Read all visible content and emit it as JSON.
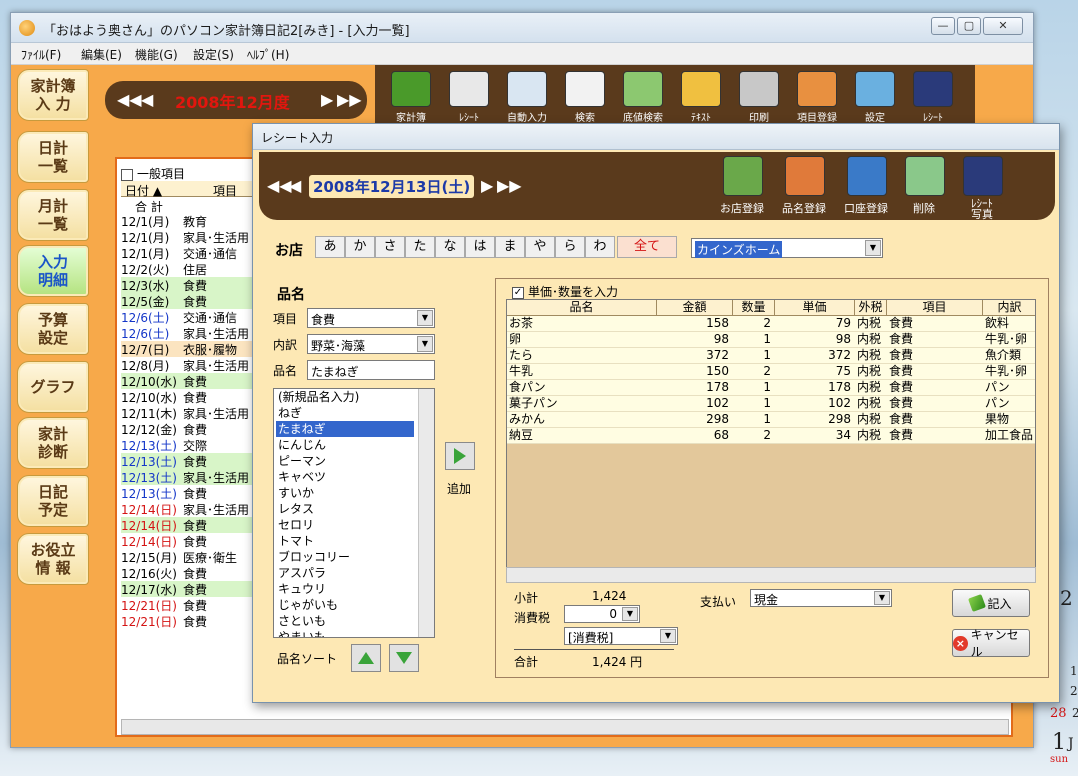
{
  "main_window": {
    "title": "「おはよう奥さん」のパソコン家計簿日記2[みき] - [入力一覧]",
    "menu": [
      "ﾌｧｲﾙ(F)",
      "編集(E)",
      "機能(G)",
      "設定(S)",
      "ﾍﾙﾌﾟ(H)"
    ],
    "win_controls": [
      "—",
      "▢",
      "✕"
    ]
  },
  "sidebar": {
    "items": [
      {
        "label": "家計簿\n入 力"
      },
      {
        "label": "日計\n一覧"
      },
      {
        "label": "月計\n一覧"
      },
      {
        "label": "入力\n明細"
      },
      {
        "label": "予算\n設定"
      },
      {
        "label": "グラフ"
      },
      {
        "label": "家計\n診断"
      },
      {
        "label": "日記\n予定"
      },
      {
        "label": "お役立\n情 報"
      }
    ]
  },
  "month_nav": {
    "prev_prev": "◀◀",
    "prev": "◀",
    "label": "2008年12月度",
    "next": "▶",
    "next_next": "▶▶"
  },
  "main_toolbar": {
    "buttons": [
      {
        "label": "家計簿",
        "icon": "pencil-icon",
        "color": "#4a9a2a"
      },
      {
        "label": "ﾚｼｰﾄ",
        "icon": "receipt-icon",
        "color": "#e8e8e8"
      },
      {
        "label": "自動入力",
        "icon": "calendar-icon",
        "color": "#d9e6f2"
      },
      {
        "label": "検索",
        "icon": "magnifier-icon",
        "color": "#f2f2f2"
      },
      {
        "label": "底値検索",
        "icon": "vegetable-bag-icon",
        "color": "#8cc870"
      },
      {
        "label": "ﾃｷｽﾄ",
        "icon": "text-icon",
        "color": "#f0c040"
      },
      {
        "label": "印刷",
        "icon": "printer-icon",
        "color": "#c8c8c8"
      },
      {
        "label": "項目登録",
        "icon": "shop-icon",
        "color": "#e89040"
      },
      {
        "label": "設定",
        "icon": "blocks-icon",
        "color": "#6ab0e0"
      },
      {
        "label": "ﾚｼｰﾄ",
        "icon": "photo-frame-icon",
        "color": "#2a3a7a"
      }
    ]
  },
  "entry_list": {
    "header_checkbox": "一般項目",
    "col_date": "日付 ▲",
    "col_item": "項目",
    "total_label": "合 計",
    "rows": [
      {
        "date": "12/1(月)",
        "item": "教育",
        "style": "plain",
        "date_color": "black"
      },
      {
        "date": "12/1(月)",
        "item": "家具･生活用",
        "style": "plain",
        "date_color": "black"
      },
      {
        "date": "12/1(月)",
        "item": "交通･通信",
        "style": "plain",
        "date_color": "black"
      },
      {
        "date": "12/2(火)",
        "item": "住居",
        "style": "plain",
        "date_color": "black"
      },
      {
        "date": "12/3(水)",
        "item": "食費",
        "style": "green",
        "date_color": "black"
      },
      {
        "date": "12/5(金)",
        "item": "食費",
        "style": "green",
        "date_color": "black"
      },
      {
        "date": "12/6(土)",
        "item": "交通･通信",
        "style": "plain",
        "date_color": "blue"
      },
      {
        "date": "12/6(土)",
        "item": "家具･生活用",
        "style": "plain",
        "date_color": "blue"
      },
      {
        "date": "12/7(日)",
        "item": "衣服･履物",
        "style": "tan",
        "date_color": "black"
      },
      {
        "date": "12/8(月)",
        "item": "家具･生活用",
        "style": "plain",
        "date_color": "black"
      },
      {
        "date": "12/10(水)",
        "item": "食費",
        "style": "green",
        "date_color": "black"
      },
      {
        "date": "12/10(水)",
        "item": "食費",
        "style": "plain",
        "date_color": "black"
      },
      {
        "date": "12/11(木)",
        "item": "家具･生活用",
        "style": "plain",
        "date_color": "black"
      },
      {
        "date": "12/12(金)",
        "item": "食費",
        "style": "plain",
        "date_color": "black"
      },
      {
        "date": "12/13(土)",
        "item": "交際",
        "style": "plain",
        "date_color": "blue"
      },
      {
        "date": "12/13(土)",
        "item": "食費",
        "style": "green",
        "date_color": "blue"
      },
      {
        "date": "12/13(土)",
        "item": "家具･生活用",
        "style": "green",
        "date_color": "blue"
      },
      {
        "date": "12/13(土)",
        "item": "食費",
        "style": "plain",
        "date_color": "blue"
      },
      {
        "date": "12/14(日)",
        "item": "家具･生活用",
        "style": "plain",
        "date_color": "red"
      },
      {
        "date": "12/14(日)",
        "item": "食費",
        "style": "green",
        "date_color": "red"
      },
      {
        "date": "12/14(日)",
        "item": "食費",
        "style": "plain",
        "date_color": "red"
      },
      {
        "date": "12/15(月)",
        "item": "医療･衛生",
        "style": "plain",
        "date_color": "black"
      },
      {
        "date": "12/16(火)",
        "item": "食費",
        "style": "plain",
        "date_color": "black"
      },
      {
        "date": "12/17(水)",
        "item": "食費",
        "style": "green",
        "date_color": "black"
      },
      {
        "date": "12/21(日)",
        "item": "食費",
        "style": "plain",
        "date_color": "red"
      },
      {
        "date": "12/21(日)",
        "item": "食費",
        "style": "plain",
        "date_color": "red"
      }
    ]
  },
  "dialog": {
    "title": "レシート入力",
    "date_nav": {
      "prev_prev": "◀◀",
      "prev": "◀",
      "label": "2008年12月13日(土)",
      "next": "▶",
      "next_next": "▶▶"
    },
    "tools": [
      {
        "label": "お店登録",
        "icon": "shop-register-icon",
        "color": "#6aa84a"
      },
      {
        "label": "品名登録",
        "icon": "item-register-icon",
        "color": "#e07a3a"
      },
      {
        "label": "口座登録",
        "icon": "bank-card-icon",
        "color": "#3a7ac8"
      },
      {
        "label": "削除",
        "icon": "trash-icon",
        "color": "#8ac88a"
      },
      {
        "label": "ﾚｼｰﾄ\n写真",
        "icon": "photo-frame-icon",
        "color": "#2a3a7a"
      }
    ],
    "shop": {
      "label": "お店",
      "kana": [
        "あ",
        "か",
        "さ",
        "た",
        "な",
        "は",
        "ま",
        "や",
        "ら",
        "わ"
      ],
      "all_label": "全て",
      "selected": "カインズホーム"
    },
    "item": {
      "heading": "品名",
      "category_label": "項目",
      "category_value": "食費",
      "subcategory_label": "内訳",
      "subcategory_value": "野菜･海藻",
      "name_label": "品名",
      "name_value": "たまねぎ",
      "options": [
        "(新規品名入力)",
        "ねぎ",
        "たまねぎ",
        "にんじん",
        "ピーマン",
        "キャベツ",
        "すいか",
        "レタス",
        "セロリ",
        "トマト",
        "ブロッコリー",
        "アスパラ",
        "キュウリ",
        "じゃがいも",
        "さといも",
        "やまいも"
      ],
      "selected_index": 2,
      "add_label": "追加",
      "sort_label": "品名ソート"
    },
    "grid": {
      "checkbox_label": "単価･数量を入力",
      "checkbox_mark": "✓",
      "columns": [
        "品名",
        "金額",
        "数量",
        "単価",
        "外税",
        "項目",
        "内訳"
      ],
      "rows": [
        {
          "name": "お茶",
          "amount": "158",
          "qty": "2",
          "unit": "79",
          "tax": "内税",
          "cat": "食費",
          "sub": "飲料"
        },
        {
          "name": "卵",
          "amount": "98",
          "qty": "1",
          "unit": "98",
          "tax": "内税",
          "cat": "食費",
          "sub": "牛乳･卵"
        },
        {
          "name": "たら",
          "amount": "372",
          "qty": "1",
          "unit": "372",
          "tax": "内税",
          "cat": "食費",
          "sub": "魚介類"
        },
        {
          "name": "牛乳",
          "amount": "150",
          "qty": "2",
          "unit": "75",
          "tax": "内税",
          "cat": "食費",
          "sub": "牛乳･卵"
        },
        {
          "name": "食パン",
          "amount": "178",
          "qty": "1",
          "unit": "178",
          "tax": "内税",
          "cat": "食費",
          "sub": "パン"
        },
        {
          "name": "菓子パン",
          "amount": "102",
          "qty": "1",
          "unit": "102",
          "tax": "内税",
          "cat": "食費",
          "sub": "パン"
        },
        {
          "name": "みかん",
          "amount": "298",
          "qty": "1",
          "unit": "298",
          "tax": "内税",
          "cat": "食費",
          "sub": "果物"
        },
        {
          "name": "納豆",
          "amount": "68",
          "qty": "2",
          "unit": "34",
          "tax": "内税",
          "cat": "食費",
          "sub": "加工食品"
        }
      ]
    },
    "totals": {
      "subtotal_label": "小計",
      "subtotal_value": "1,424",
      "tax_label": "消費税",
      "tax_value": "0",
      "tax_mode": "[消費税]",
      "total_label": "合計",
      "total_value": "1,424 円",
      "payment_label": "支払い",
      "payment_value": "現金"
    },
    "buttons": {
      "record": "記入",
      "cancel": "キャンセル"
    }
  },
  "desktop_calendar": {
    "big_digit_top": "2",
    "small_digits": [
      "1",
      "2",
      "2"
    ],
    "red_date": "28",
    "big_digit_bottom": "1",
    "month_letter": "J",
    "weekday": "sun"
  }
}
